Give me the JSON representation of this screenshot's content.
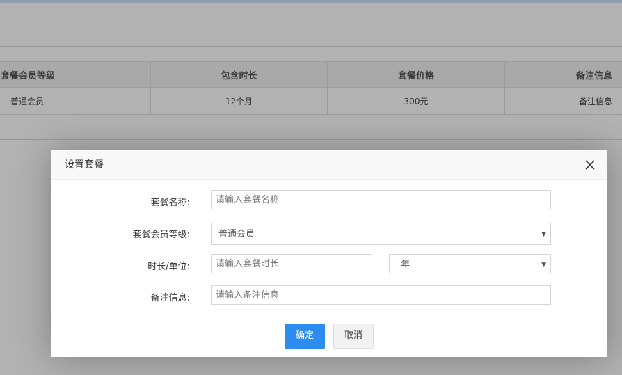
{
  "table": {
    "headers": [
      "套餐会员等级",
      "包含时长",
      "套餐价格",
      "备注信息"
    ],
    "rows": [
      [
        "普通会员",
        "12个月",
        "300元",
        "备注信息"
      ]
    ]
  },
  "dialog": {
    "title": "设置套餐",
    "fields": {
      "package_name": {
        "label": "套餐名称:",
        "value": "",
        "placeholder": "请输入套餐名称"
      },
      "member_level": {
        "label": "套餐会员等级:",
        "selected": "普通会员"
      },
      "duration": {
        "label": "时长/单位:",
        "value": "",
        "placeholder": "请输入套餐时长",
        "unit_selected": "年"
      },
      "remark": {
        "label": "备注信息:",
        "value": "",
        "placeholder": "请输入备注信息"
      }
    },
    "buttons": {
      "confirm": "确定",
      "cancel": "取消"
    }
  },
  "colors": {
    "primary": "#2d8cf0",
    "mask": "rgba(0,0,0,0.3)"
  },
  "icons": {
    "close": "close-icon",
    "dropdown": "chevron-down-icon"
  }
}
